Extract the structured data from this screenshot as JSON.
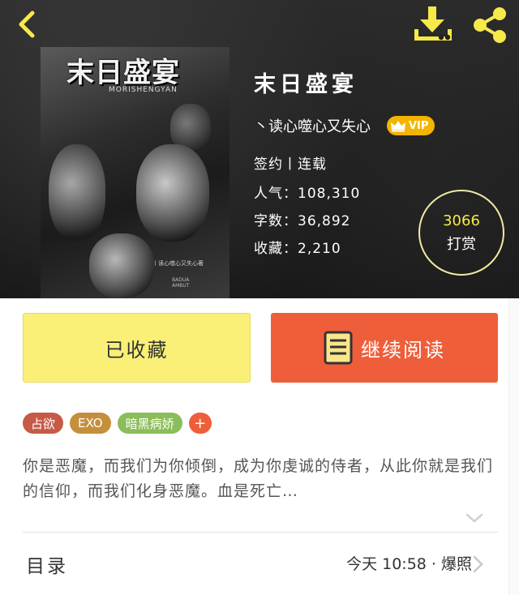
{
  "book": {
    "title": "末日盛宴",
    "author": "丶读心噬心又失心",
    "vip_label": "VIP",
    "status": "签约丨连载",
    "popularity": "人气：108,310",
    "word_count": "字数：36,892",
    "favorites": "收藏：2,210"
  },
  "cover": {
    "title": "末日盛宴",
    "subtitle": "MORISHENGYAN",
    "author_line": "丨读心噬心又失心著",
    "badge_line1": "BADUA",
    "badge_line2": "AMBUT"
  },
  "tip": {
    "count": "3066",
    "label": "打赏"
  },
  "actions": {
    "collected_label": "已收藏",
    "continue_label": "继续阅读"
  },
  "tags": [
    "占欲",
    "EXO",
    "暗黑病娇"
  ],
  "tag_add": "+",
  "description": "你是恶魔，而我们为你倾倒，成为你虔诚的侍者，从此你就是我们的信仰，而我们化身恶魔。血是死亡…",
  "catalog": {
    "label": "目录",
    "update": "今天 10:58 · 爆照"
  },
  "icons": {
    "back": "chevron-left-icon",
    "download": "download-icon",
    "share": "share-icon",
    "crown": "crown-icon",
    "book": "book-icon",
    "expand": "chevron-down-icon",
    "chevron": "chevron-right-icon"
  },
  "colors": {
    "accent_yellow": "#f6e94a",
    "collected_bg": "#fbf077",
    "read_bg": "#ef5e3a",
    "vip_bg": "#f4b400"
  }
}
